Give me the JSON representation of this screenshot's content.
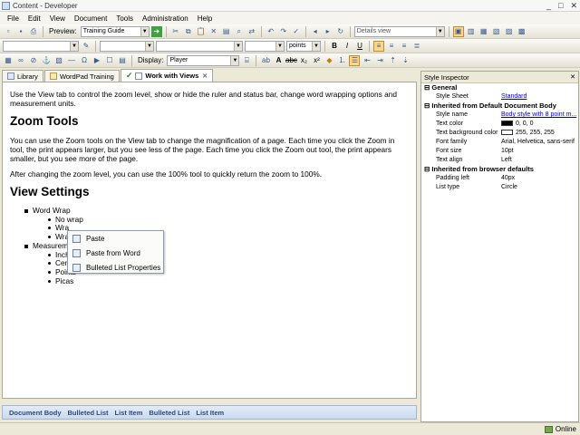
{
  "window": {
    "title": "Content - Developer",
    "controls": [
      "_",
      "□",
      "✕"
    ]
  },
  "menu": [
    "File",
    "Edit",
    "View",
    "Document",
    "Tools",
    "Administration",
    "Help"
  ],
  "toolbar1": {
    "preview_label": "Preview:",
    "preview_value": "Training Guide",
    "view_value": "Details view"
  },
  "toolbar2": {
    "font_value": "",
    "size_value": "",
    "points_value": "points"
  },
  "toolbar3": {
    "display_label": "Display:",
    "display_value": "Player"
  },
  "tabs": [
    {
      "label": "Library",
      "active": false
    },
    {
      "label": "WordPad Training",
      "active": false
    },
    {
      "label": "Work with Views",
      "active": true
    }
  ],
  "document": {
    "intro": "Use the View tab to control the zoom level, show or hide the ruler and status bar, change word wrapping options and measurement units.",
    "heading1": "Zoom Tools",
    "para1": "You can use the Zoom tools on the View tab to change the magnification of a page. Each time you click the Zoom in tool, the print appears larger, but you see less of the page. Each time you click the Zoom out tool, the print appears smaller, but you see more of the page.",
    "para2": "After changing the zoom level, you can use the 100% tool to quickly return the zoom to 100%.",
    "heading2": "View Settings",
    "list": [
      {
        "label": "Word Wrap",
        "children": [
          "No wrap",
          "Wra",
          "Wra"
        ]
      },
      {
        "label": "Measureme",
        "children": [
          "Inch",
          "Cent",
          "Points",
          "Picas"
        ]
      }
    ]
  },
  "context_menu": [
    "Paste",
    "Paste from Word",
    "Bulleted List Properties"
  ],
  "breadcrumb": [
    "Document Body",
    "Bulleted List",
    "List Item",
    "Bulleted List",
    "List Item"
  ],
  "inspector": {
    "title": "Style Inspector",
    "groups": [
      {
        "name": "General",
        "rows": [
          {
            "key": "Style Sheet",
            "value": "Standard",
            "link": true
          }
        ]
      },
      {
        "name": "Inherited from Default Document Body",
        "rows": [
          {
            "key": "Style name",
            "value": "Body style with 8 point m...",
            "link": true
          },
          {
            "key": "Text color",
            "value": "0, 0, 0",
            "swatch": "#000000"
          },
          {
            "key": "Text background color",
            "value": "255, 255, 255",
            "swatch": "#ffffff"
          },
          {
            "key": "Font family",
            "value": "Arial, Helvetica, sans-serif"
          },
          {
            "key": "Font size",
            "value": "10pt"
          },
          {
            "key": "Text align",
            "value": "Left"
          }
        ]
      },
      {
        "name": "Inherited from browser defaults",
        "rows": [
          {
            "key": "Padding left",
            "value": "40px"
          },
          {
            "key": "List type",
            "value": "Circle"
          }
        ]
      }
    ]
  },
  "status": {
    "online": "Online"
  },
  "colors": {
    "accent": "#ffd587",
    "link": "#0000cc",
    "breadcrumb_text": "#2b4a7c"
  }
}
